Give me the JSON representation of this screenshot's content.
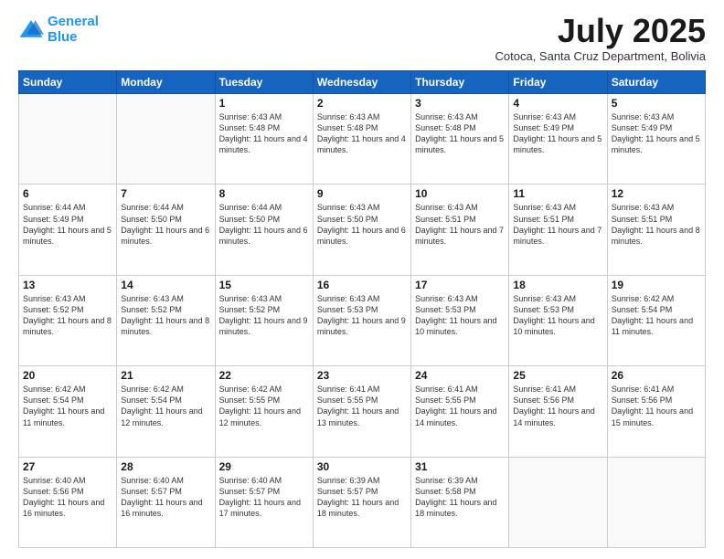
{
  "header": {
    "logo_line1": "General",
    "logo_line2": "Blue",
    "month": "July 2025",
    "location": "Cotoca, Santa Cruz Department, Bolivia"
  },
  "days_of_week": [
    "Sunday",
    "Monday",
    "Tuesday",
    "Wednesday",
    "Thursday",
    "Friday",
    "Saturday"
  ],
  "weeks": [
    [
      {
        "day": "",
        "info": ""
      },
      {
        "day": "",
        "info": ""
      },
      {
        "day": "1",
        "info": "Sunrise: 6:43 AM\nSunset: 5:48 PM\nDaylight: 11 hours and 4 minutes."
      },
      {
        "day": "2",
        "info": "Sunrise: 6:43 AM\nSunset: 5:48 PM\nDaylight: 11 hours and 4 minutes."
      },
      {
        "day": "3",
        "info": "Sunrise: 6:43 AM\nSunset: 5:48 PM\nDaylight: 11 hours and 5 minutes."
      },
      {
        "day": "4",
        "info": "Sunrise: 6:43 AM\nSunset: 5:49 PM\nDaylight: 11 hours and 5 minutes."
      },
      {
        "day": "5",
        "info": "Sunrise: 6:43 AM\nSunset: 5:49 PM\nDaylight: 11 hours and 5 minutes."
      }
    ],
    [
      {
        "day": "6",
        "info": "Sunrise: 6:44 AM\nSunset: 5:49 PM\nDaylight: 11 hours and 5 minutes."
      },
      {
        "day": "7",
        "info": "Sunrise: 6:44 AM\nSunset: 5:50 PM\nDaylight: 11 hours and 6 minutes."
      },
      {
        "day": "8",
        "info": "Sunrise: 6:44 AM\nSunset: 5:50 PM\nDaylight: 11 hours and 6 minutes."
      },
      {
        "day": "9",
        "info": "Sunrise: 6:43 AM\nSunset: 5:50 PM\nDaylight: 11 hours and 6 minutes."
      },
      {
        "day": "10",
        "info": "Sunrise: 6:43 AM\nSunset: 5:51 PM\nDaylight: 11 hours and 7 minutes."
      },
      {
        "day": "11",
        "info": "Sunrise: 6:43 AM\nSunset: 5:51 PM\nDaylight: 11 hours and 7 minutes."
      },
      {
        "day": "12",
        "info": "Sunrise: 6:43 AM\nSunset: 5:51 PM\nDaylight: 11 hours and 8 minutes."
      }
    ],
    [
      {
        "day": "13",
        "info": "Sunrise: 6:43 AM\nSunset: 5:52 PM\nDaylight: 11 hours and 8 minutes."
      },
      {
        "day": "14",
        "info": "Sunrise: 6:43 AM\nSunset: 5:52 PM\nDaylight: 11 hours and 8 minutes."
      },
      {
        "day": "15",
        "info": "Sunrise: 6:43 AM\nSunset: 5:52 PM\nDaylight: 11 hours and 9 minutes."
      },
      {
        "day": "16",
        "info": "Sunrise: 6:43 AM\nSunset: 5:53 PM\nDaylight: 11 hours and 9 minutes."
      },
      {
        "day": "17",
        "info": "Sunrise: 6:43 AM\nSunset: 5:53 PM\nDaylight: 11 hours and 10 minutes."
      },
      {
        "day": "18",
        "info": "Sunrise: 6:43 AM\nSunset: 5:53 PM\nDaylight: 11 hours and 10 minutes."
      },
      {
        "day": "19",
        "info": "Sunrise: 6:42 AM\nSunset: 5:54 PM\nDaylight: 11 hours and 11 minutes."
      }
    ],
    [
      {
        "day": "20",
        "info": "Sunrise: 6:42 AM\nSunset: 5:54 PM\nDaylight: 11 hours and 11 minutes."
      },
      {
        "day": "21",
        "info": "Sunrise: 6:42 AM\nSunset: 5:54 PM\nDaylight: 11 hours and 12 minutes."
      },
      {
        "day": "22",
        "info": "Sunrise: 6:42 AM\nSunset: 5:55 PM\nDaylight: 11 hours and 12 minutes."
      },
      {
        "day": "23",
        "info": "Sunrise: 6:41 AM\nSunset: 5:55 PM\nDaylight: 11 hours and 13 minutes."
      },
      {
        "day": "24",
        "info": "Sunrise: 6:41 AM\nSunset: 5:55 PM\nDaylight: 11 hours and 14 minutes."
      },
      {
        "day": "25",
        "info": "Sunrise: 6:41 AM\nSunset: 5:56 PM\nDaylight: 11 hours and 14 minutes."
      },
      {
        "day": "26",
        "info": "Sunrise: 6:41 AM\nSunset: 5:56 PM\nDaylight: 11 hours and 15 minutes."
      }
    ],
    [
      {
        "day": "27",
        "info": "Sunrise: 6:40 AM\nSunset: 5:56 PM\nDaylight: 11 hours and 16 minutes."
      },
      {
        "day": "28",
        "info": "Sunrise: 6:40 AM\nSunset: 5:57 PM\nDaylight: 11 hours and 16 minutes."
      },
      {
        "day": "29",
        "info": "Sunrise: 6:40 AM\nSunset: 5:57 PM\nDaylight: 11 hours and 17 minutes."
      },
      {
        "day": "30",
        "info": "Sunrise: 6:39 AM\nSunset: 5:57 PM\nDaylight: 11 hours and 18 minutes."
      },
      {
        "day": "31",
        "info": "Sunrise: 6:39 AM\nSunset: 5:58 PM\nDaylight: 11 hours and 18 minutes."
      },
      {
        "day": "",
        "info": ""
      },
      {
        "day": "",
        "info": ""
      }
    ]
  ]
}
